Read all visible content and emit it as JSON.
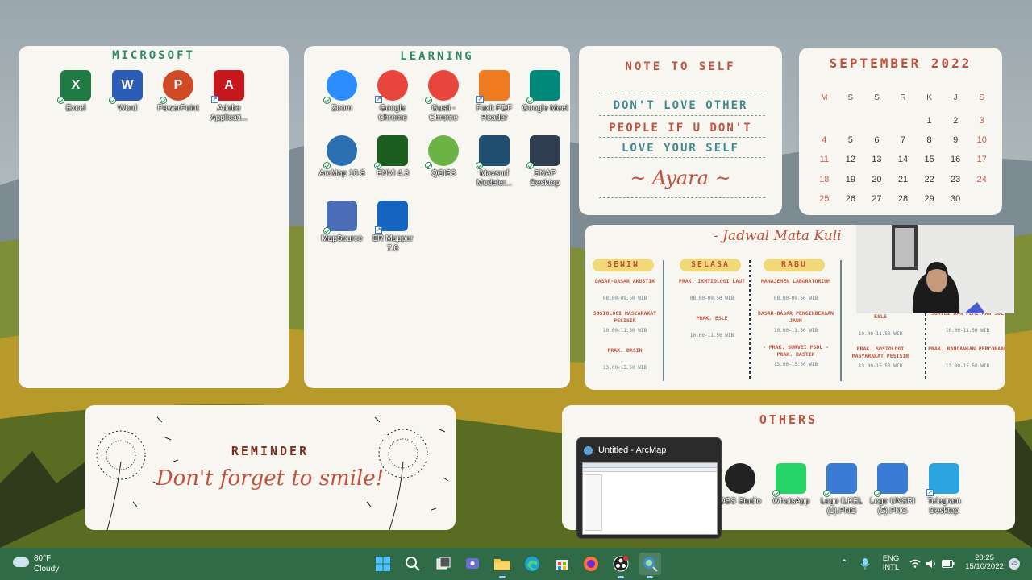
{
  "panels": {
    "microsoft": {
      "title": "MICROSOFT",
      "icons": [
        {
          "label": "Excel",
          "icon": "excel-icon",
          "letter": "X",
          "color": "#1f7a43"
        },
        {
          "label": "Word",
          "icon": "word-icon",
          "letter": "W",
          "color": "#2b5cb8"
        },
        {
          "label": "PowerPoint",
          "icon": "powerpoint-icon",
          "letter": "P",
          "color": "#d04a26"
        },
        {
          "label": "Adobe Applicati...",
          "icon": "adobe-icon",
          "letter": "A",
          "color": "#c8161d"
        }
      ]
    },
    "learning": {
      "title": "LEARNING",
      "icons": [
        {
          "label": "Zoom",
          "icon": "zoom-icon",
          "color": "#2d8cff"
        },
        {
          "label": "Google Chrome",
          "icon": "chrome-icon",
          "color": "#e8453c"
        },
        {
          "label": "Gusti - Chrome",
          "icon": "chrome-profile-icon",
          "color": "#e8453c"
        },
        {
          "label": "Foxit PDF Reader",
          "icon": "foxit-icon",
          "color": "#f07a20"
        },
        {
          "label": "Google Meet",
          "icon": "meet-icon",
          "color": "#00897b"
        },
        {
          "label": "ArcMap 10.8",
          "icon": "arcmap-icon",
          "color": "#2a6fb0"
        },
        {
          "label": "ENVI 4.3",
          "icon": "envi-icon",
          "color": "#1b5e20"
        },
        {
          "label": "QGIS3",
          "icon": "qgis-icon",
          "color": "#6ab344"
        },
        {
          "label": "Maxsurf Modeler...",
          "icon": "maxsurf-icon",
          "color": "#1e4f6e"
        },
        {
          "label": "SNAP Desktop",
          "icon": "snap-icon",
          "color": "#2e3d4f"
        },
        {
          "label": "MapSource",
          "icon": "mapsource-icon",
          "color": "#4b6cb7"
        },
        {
          "label": "ER Mapper 7.0",
          "icon": "ermapper-icon",
          "color": "#1565c0"
        }
      ]
    },
    "note": {
      "title": "NOTE TO SELF",
      "lines": [
        "DON'T LOVE OTHER",
        "PEOPLE IF U DON'T",
        "LOVE YOUR SELF"
      ],
      "signature": "~ Ayara ~"
    },
    "calendar": {
      "title": "SEPTEMBER 2022",
      "weekdays": [
        "M",
        "S",
        "S",
        "R",
        "K",
        "J",
        "S"
      ],
      "weeks": [
        [
          "",
          "",
          "",
          "",
          "1",
          "2",
          "3"
        ],
        [
          "4",
          "5",
          "6",
          "7",
          "8",
          "9",
          "10"
        ],
        [
          "11",
          "12",
          "13",
          "14",
          "15",
          "16",
          "17"
        ],
        [
          "18",
          "19",
          "20",
          "21",
          "22",
          "23",
          "24"
        ],
        [
          "25",
          "26",
          "27",
          "28",
          "29",
          "30",
          ""
        ]
      ]
    },
    "schedule": {
      "title": "- Jadwal Mata Kuli",
      "days": [
        {
          "name": "SENIN",
          "courses": [
            {
              "name": "DASAR-DASAR AKUSTIK",
              "time": "08.00-09.50 WIB"
            },
            {
              "name": "SOSIOLOGI MASYARAKAT PESISIR",
              "time": "10.00-11.50 WIB"
            },
            {
              "name": "PRAK. DASIN",
              "time": "13.00-15.50 WIB"
            }
          ]
        },
        {
          "name": "SELASA",
          "courses": [
            {
              "name": "PRAK. IKHTIOLOGI LAUT",
              "time": "08.00-09.50 WIB"
            },
            {
              "name": "PRAK. ESLE",
              "time": "10.00-11.50 WIB"
            }
          ]
        },
        {
          "name": "RABU",
          "courses": [
            {
              "name": "MANAJEMEN LABORATORIUM",
              "time": "08.00-09.50 WIB"
            },
            {
              "name": "DASAR-DASAR PENGINDERAAN JAUH",
              "time": "10.00-11.50 WIB"
            },
            {
              "name": "- PRAK. SURVEI PSDL - PRAK. DASTIK",
              "time": "13.00-15.50 WIB"
            }
          ]
        },
        {
          "name": "",
          "courses": [
            {
              "name": "ESLE",
              "time": "10.00-11.50 WIB"
            },
            {
              "name": "PRAK. SOSIOLOGI MASYARAKAT PESISIR",
              "time": "13.00-15.50 WIB"
            }
          ]
        },
        {
          "name": "",
          "courses": [
            {
              "name": "SURVEI DAN PEMETAAN SDL",
              "time": "10.00-11.50 WIB"
            },
            {
              "name": "PRAK. RANCANGAN PERCOBAAN",
              "time": "13.00-15.50 WIB"
            }
          ]
        }
      ]
    },
    "reminder": {
      "title": "REMINDER",
      "text": "Don't forget to smile!"
    },
    "others": {
      "title": "OTHERS",
      "icons": [
        {
          "label": "OBS Studio",
          "icon": "obs-icon",
          "color": "#222222"
        },
        {
          "label": "WhatsApp",
          "icon": "whatsapp-icon",
          "color": "#25d366"
        },
        {
          "label": "Logo ILKEL (1).PNG",
          "icon": "image-file-icon",
          "color": "#3a7bd5"
        },
        {
          "label": "Logo UNSRI (2).PNG",
          "icon": "image-file-icon",
          "color": "#3a7bd5"
        },
        {
          "label": "Telegram Desktop",
          "icon": "telegram-icon",
          "color": "#2aa3df"
        }
      ]
    }
  },
  "taskbar_preview": {
    "title": "Untitled - ArcMap"
  },
  "taskbar": {
    "weather": {
      "temp": "80°F",
      "condition": "Cloudy"
    },
    "apps": [
      "start-icon",
      "search-icon",
      "task-view-icon",
      "teams-chat-icon",
      "file-explorer-icon",
      "edge-icon",
      "store-icon",
      "firefox-icon",
      "obs-icon",
      "arcmap-icon"
    ],
    "lang": {
      "line1": "ENG",
      "line2": "INTL"
    },
    "clock": {
      "time": "20:25",
      "date": "15/10/2022"
    },
    "notifications": "25"
  }
}
